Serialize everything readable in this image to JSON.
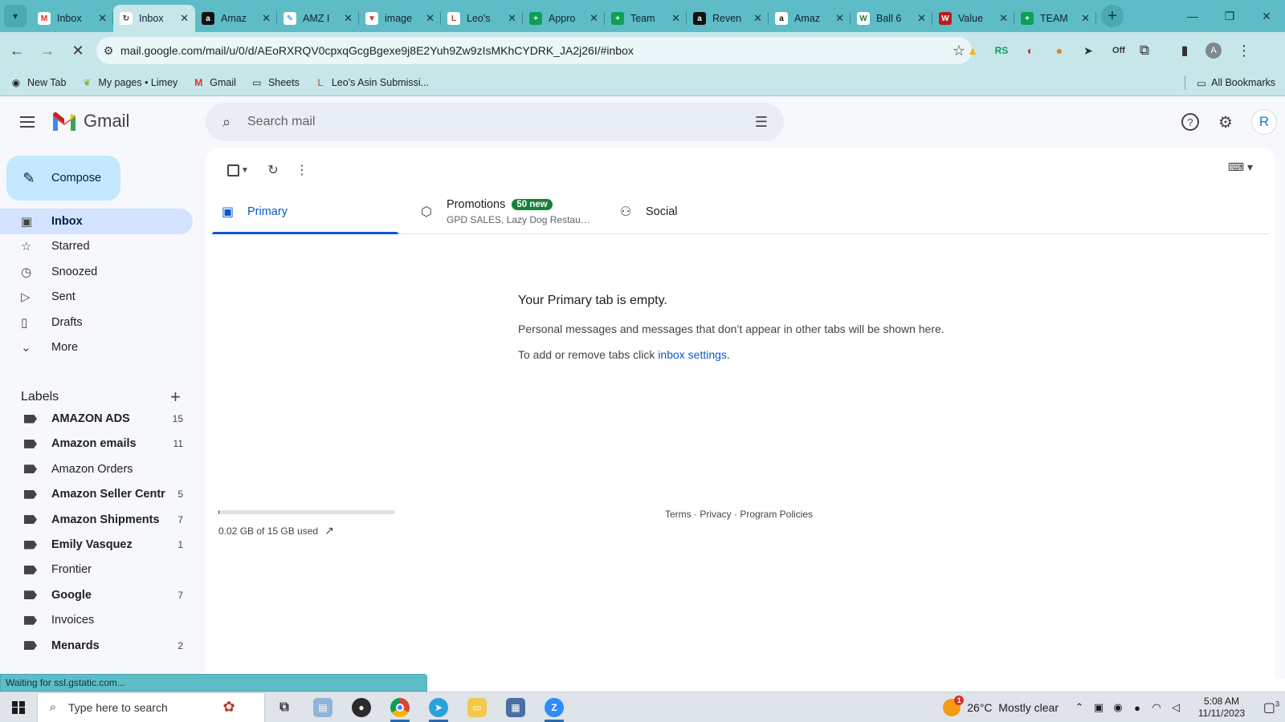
{
  "browser": {
    "tabs": [
      {
        "title": "Inbox",
        "fav_bg": "#ffffff",
        "fav": "M",
        "fav_color": "#d93025"
      },
      {
        "title": "Inbox",
        "fav_bg": "#ffffff",
        "fav": "↻",
        "fav_color": "#333333"
      },
      {
        "title": "Amaz",
        "fav_bg": "#111111",
        "fav": "a",
        "fav_color": "#ffffff"
      },
      {
        "title": "AMZ I",
        "fav_bg": "#ffffff",
        "fav": "✎",
        "fav_color": "#1a73e8"
      },
      {
        "title": "image",
        "fav_bg": "#ffffff",
        "fav": "▼",
        "fav_color": "#c0392b"
      },
      {
        "title": "Leo's",
        "fav_bg": "#ffffff",
        "fav": "L",
        "fav_color": "#c0392b"
      },
      {
        "title": "Appro",
        "fav_bg": "#0f9d58",
        "fav": "+",
        "fav_color": "#ffffff"
      },
      {
        "title": "Team",
        "fav_bg": "#0f9d58",
        "fav": "+",
        "fav_color": "#ffffff"
      },
      {
        "title": "Reven",
        "fav_bg": "#111111",
        "fav": "a",
        "fav_color": "#ffffff"
      },
      {
        "title": "Amaz",
        "fav_bg": "#ffffff",
        "fav": "a",
        "fav_color": "#111111"
      },
      {
        "title": "Ball 6",
        "fav_bg": "#ffffff",
        "fav": "W",
        "fav_color": "#2e7d32"
      },
      {
        "title": "Value",
        "fav_bg": "#b71c1c",
        "fav": "W",
        "fav_color": "#ffffff"
      },
      {
        "title": "TEAM",
        "fav_bg": "#0f9d58",
        "fav": "+",
        "fav_color": "#ffffff"
      }
    ],
    "url": "mail.google.com/mail/u/0/d/AEoRXRQV0cpxqGcgBgexe9j8E2Yuh9Zw9zIsMKhCYDRK_JA2j26I/#inbox",
    "bookmarks": [
      {
        "label": "New Tab"
      },
      {
        "label": "My pages • Limey"
      },
      {
        "label": "Gmail"
      },
      {
        "label": "Sheets"
      },
      {
        "label": "Leo's Asin Submissi..."
      }
    ],
    "all_bookmarks": "All Bookmarks",
    "status": "Waiting for ssl.gstatic.com..."
  },
  "gmail": {
    "brand": "Gmail",
    "search_placeholder": "Search mail",
    "avatar_letter": "R",
    "compose": "Compose",
    "nav": [
      {
        "label": "Inbox",
        "icon": "inbox-icon",
        "glyph": "▣",
        "active": true
      },
      {
        "label": "Starred",
        "icon": "star-icon",
        "glyph": "☆",
        "active": false
      },
      {
        "label": "Snoozed",
        "icon": "clock-icon",
        "glyph": "◷",
        "active": false
      },
      {
        "label": "Sent",
        "icon": "send-icon",
        "glyph": "▷",
        "active": false
      },
      {
        "label": "Drafts",
        "icon": "draft-icon",
        "glyph": "▯",
        "active": false
      },
      {
        "label": "More",
        "icon": "chevron-down-icon",
        "glyph": "⌄",
        "active": false
      }
    ],
    "labels_heading": "Labels",
    "labels": [
      {
        "name": "AMAZON ADS",
        "count": "15",
        "bold": true
      },
      {
        "name": "Amazon emails",
        "count": "11",
        "bold": true
      },
      {
        "name": "Amazon Orders",
        "count": "",
        "bold": false
      },
      {
        "name": "Amazon Seller Centr",
        "count": "5",
        "bold": true
      },
      {
        "name": "Amazon Shipments",
        "count": "7",
        "bold": true
      },
      {
        "name": "Emily Vasquez",
        "count": "1",
        "bold": true
      },
      {
        "name": "Frontier",
        "count": "",
        "bold": false
      },
      {
        "name": "Google",
        "count": "7",
        "bold": true
      },
      {
        "name": "Invoices",
        "count": "",
        "bold": false
      },
      {
        "name": "Menards",
        "count": "2",
        "bold": true
      }
    ],
    "tabs": {
      "primary": "Primary",
      "promotions": "Promotions",
      "promotions_badge": "50 new",
      "promotions_sub": "GPD SALES, Lazy Dog Restaura...",
      "social": "Social"
    },
    "empty": {
      "title": "Your Primary tab is empty.",
      "line1": "Personal messages and messages that don’t appear in other tabs will be shown here.",
      "line2_prefix": "To add or remove tabs click ",
      "line2_link": "inbox settings",
      "line2_suffix": "."
    },
    "storage": {
      "text": "0.02 GB of 15 GB used",
      "fraction": 0.0013
    },
    "footer": "Terms · Privacy · Program Policies"
  },
  "taskbar": {
    "search_placeholder": "Type here to search",
    "weather_badge": "1",
    "weather_text": "26°C  Mostly clear",
    "time": "5:08 AM",
    "date": "11/11/2023",
    "notif_count": "3"
  }
}
